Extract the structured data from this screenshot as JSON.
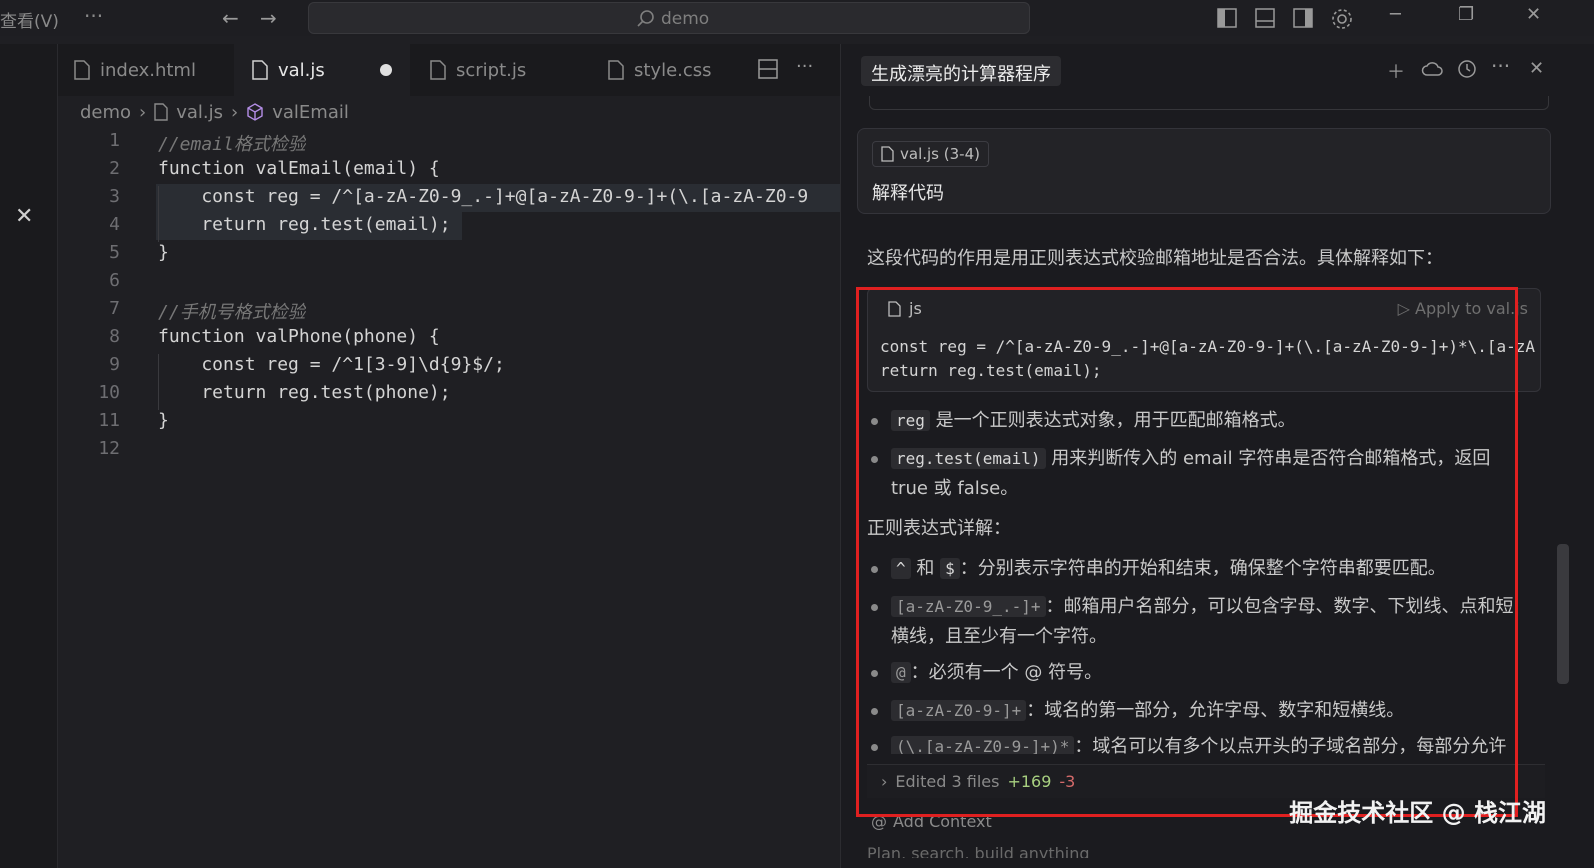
{
  "titlebar": {
    "menu_label": "查看(V)",
    "more": "···",
    "search_text": "demo"
  },
  "editor": {
    "tabs": [
      {
        "label": "index.html"
      },
      {
        "label": "val.js"
      },
      {
        "label": "script.js"
      },
      {
        "label": "style.css"
      }
    ],
    "breadcrumb": [
      "demo",
      "val.js",
      "valEmail"
    ],
    "line_numbers": [
      "1",
      "2",
      "3",
      "4",
      "5",
      "6",
      "7",
      "8",
      "9",
      "10",
      "11",
      "12"
    ],
    "lines": [
      "//email格式检验",
      "function valEmail(email) {",
      "    const reg = /^[a-zA-Z0-9_.-]+@[a-zA-Z0-9-]+(\\.[a-zA-Z0-9",
      "    return reg.test(email);",
      "}",
      "",
      "//手机号格式检验",
      "function valPhone(phone) {",
      "    const reg = /^1[3-9]\\d{9}$/;",
      "    return reg.test(phone);",
      "}",
      ""
    ]
  },
  "chat": {
    "title": "生成漂亮的计算器程序",
    "context_pill": "val.js (3-4)",
    "user_message": "解释代码",
    "intro": "这段代码的作用是用正则表达式校验邮箱地址是否合法。具体解释如下：",
    "code_block": {
      "lang": "js",
      "apply_label": "Apply to val.js",
      "lines": [
        "const reg = /^[a-zA-Z0-9_.-]+@[a-zA-Z0-9-]+(\\.[a-zA-Z0-9-]+)*\\.[a-zA",
        "return reg.test(email);"
      ]
    },
    "bullets_1": [
      {
        "code": "reg",
        "text": "是一个正则表达式对象，用于匹配邮箱格式。"
      },
      {
        "code": "reg.test(email)",
        "text": "用来判断传入的 email 字符串是否符合邮箱格式，返回",
        "text2": "true 或 false。"
      }
    ],
    "section_title": "正则表达式详解：",
    "bullets_2": [
      {
        "code": "^",
        "mid": "和",
        "code2": "$",
        "text": "：分别表示字符串的开始和结束，确保整个字符串都要匹配。"
      },
      {
        "code": "[a-zA-Z0-9_.-]+",
        "text": "：邮箱用户名部分，可以包含字母、数字、下划线、点和短",
        "text2": "横线，且至少有一个字符。"
      },
      {
        "code": "@",
        "text": "：必须有一个 @ 符号。"
      },
      {
        "code": "[a-zA-Z0-9-]+",
        "text": "：域名的第一部分，允许字母、数字和短横线。"
      },
      {
        "code": "(\\.[a-zA-Z0-9-]+)*",
        "text": "：域名可以有多个以点开头的子域名部分，每部分允许"
      }
    ],
    "edited": {
      "label": "Edited 3 files",
      "plus": "+169",
      "minus": "-3"
    },
    "add_context": "Add Context",
    "input_partial": "Plan, search, build anything"
  },
  "watermark": "掘金技术社区 @ 栈江湖",
  "colors": {
    "highlight_box": "#e02020",
    "accent_keyword": "#7fcfe6"
  }
}
